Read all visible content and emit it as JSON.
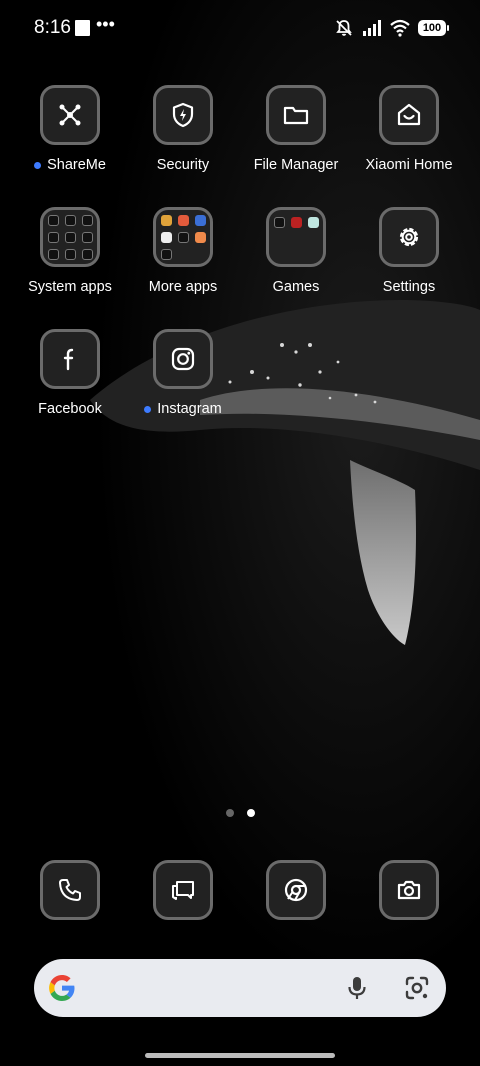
{
  "status_bar": {
    "time": "8:16",
    "battery": "100",
    "icons": [
      "square-notification-icon",
      "more-dots-icon",
      "mute-bell-icon",
      "signal-icon",
      "wifi-icon",
      "battery-icon"
    ]
  },
  "home": {
    "apps": [
      {
        "label": "ShareMe",
        "icon": "share-network-icon",
        "new": true
      },
      {
        "label": "Security",
        "icon": "shield-bolt-icon",
        "new": false
      },
      {
        "label": "File Manager",
        "icon": "folder-icon",
        "new": false
      },
      {
        "label": "Xiaomi Home",
        "icon": "home-smile-icon",
        "new": false
      },
      {
        "label": "System apps",
        "icon": "folder-grid-icon",
        "new": false
      },
      {
        "label": "More apps",
        "icon": "folder-grid-icon",
        "new": false
      },
      {
        "label": "Games",
        "icon": "folder-grid-icon",
        "new": false
      },
      {
        "label": "Settings",
        "icon": "gear-icon",
        "new": false
      },
      {
        "label": "Facebook",
        "icon": "facebook-icon",
        "new": false
      },
      {
        "label": "Instagram",
        "icon": "instagram-icon",
        "new": true
      }
    ]
  },
  "page_indicator": {
    "pages": 2,
    "current": 2
  },
  "dock": [
    {
      "icon": "phone-icon"
    },
    {
      "icon": "messages-icon"
    },
    {
      "icon": "chrome-icon"
    },
    {
      "icon": "camera-icon"
    }
  ],
  "search_bar": {
    "icons": [
      "google-logo-icon",
      "microphone-icon",
      "google-lens-icon"
    ]
  },
  "colors": {
    "accent_dot": "#3d7bff",
    "tile_border": "#6b6b6b",
    "search_bg": "#e9ebf0"
  }
}
